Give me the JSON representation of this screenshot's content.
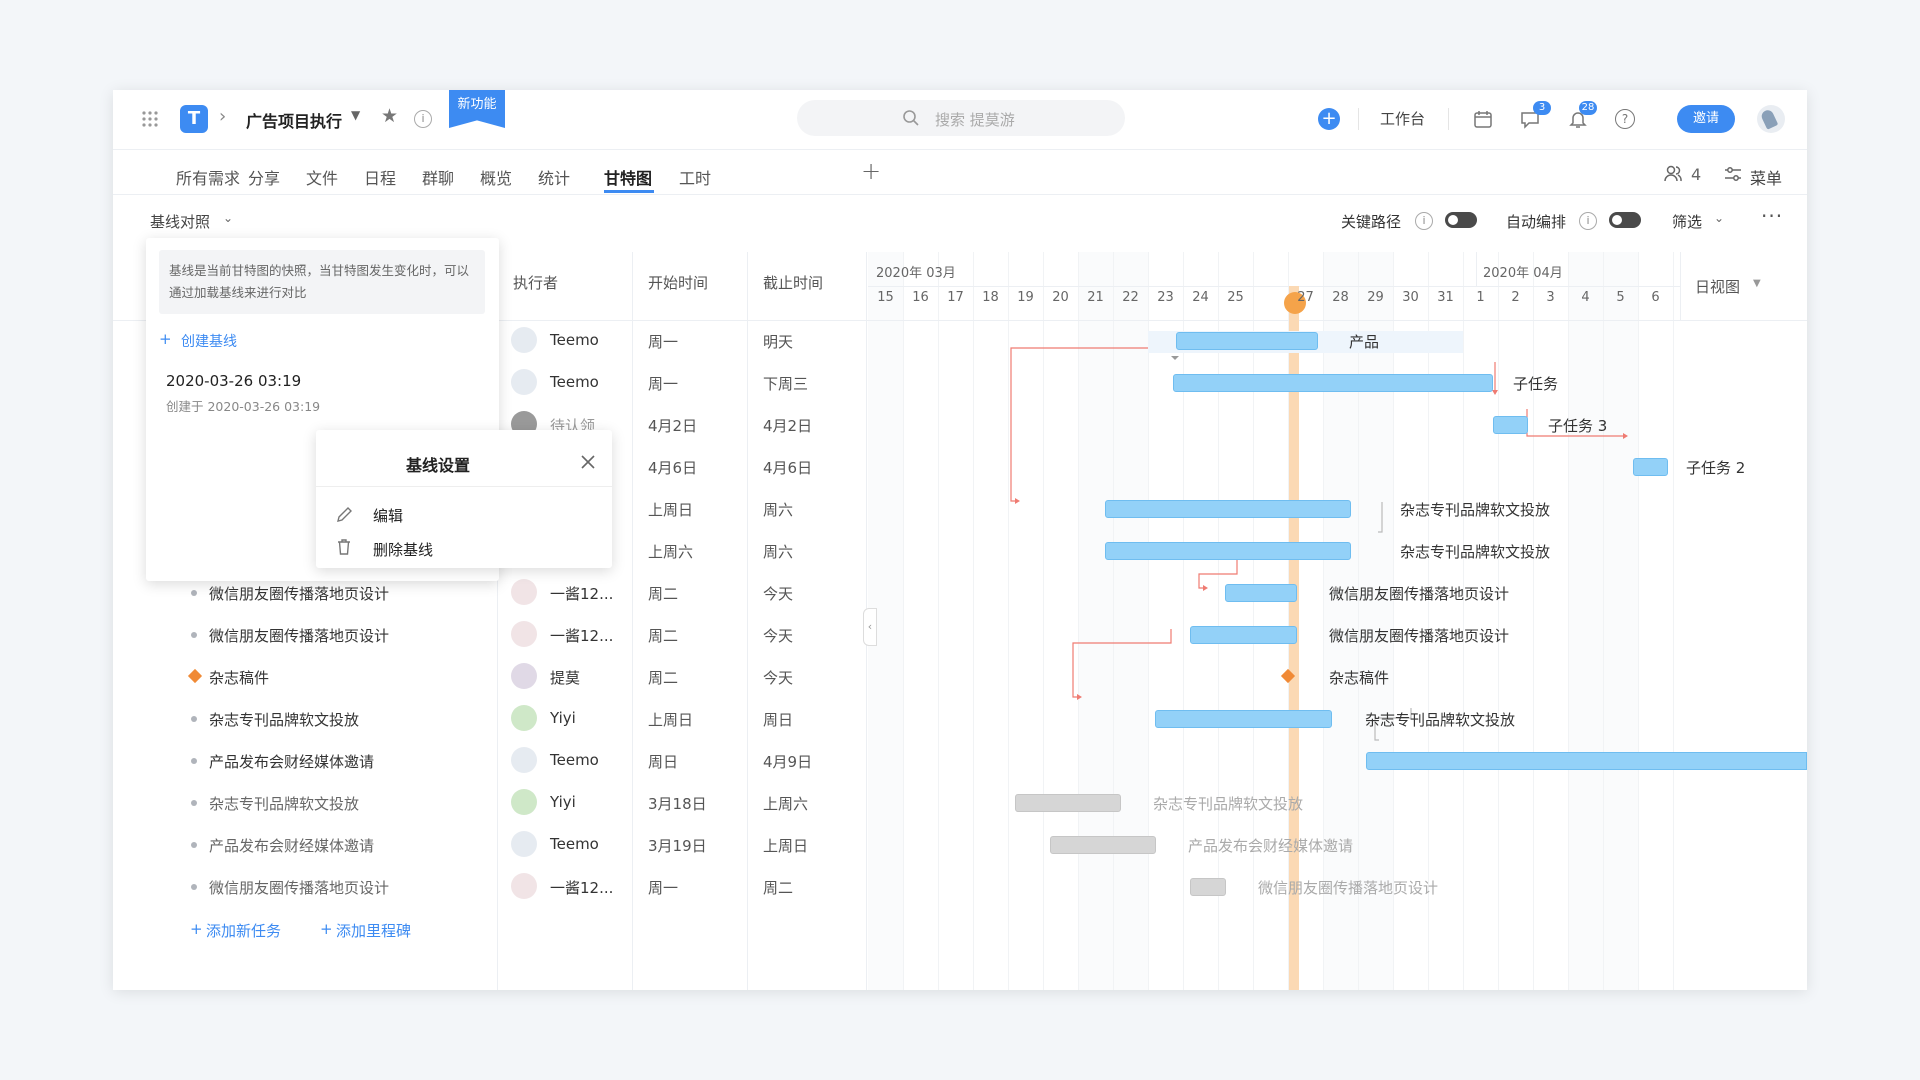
{
  "header": {
    "project_name": "广告项目执行",
    "new_feature_badge": "新功能",
    "search_placeholder": "搜索 提莫游",
    "workbench_label": "工作台",
    "message_badge": "3",
    "notification_badge": "28",
    "invite_label": "邀请"
  },
  "tabs": [
    {
      "label": "所有需求"
    },
    {
      "label": "分享"
    },
    {
      "label": "文件"
    },
    {
      "label": "日程"
    },
    {
      "label": "群聊"
    },
    {
      "label": "概览"
    },
    {
      "label": "统计"
    },
    {
      "label": "甘特图"
    },
    {
      "label": "工时"
    }
  ],
  "active_tab": "甘特图",
  "tab_right": {
    "member_count": "4",
    "menu_label": "菜单"
  },
  "toolbar": {
    "baseline_compare": "基线对照",
    "critical_path": "关键路径",
    "auto_schedule": "自动编排",
    "filter": "筛选",
    "view_mode": "日视图"
  },
  "columns": {
    "assignee": "执行者",
    "start": "开始时间",
    "due": "截止时间"
  },
  "timeline": {
    "month1": "2020年 03月",
    "month2": "2020年 04月",
    "days": [
      "15",
      "16",
      "17",
      "18",
      "19",
      "20",
      "21",
      "22",
      "23",
      "24",
      "25",
      "26",
      "27",
      "28",
      "29",
      "30",
      "31",
      "1",
      "2",
      "3",
      "4",
      "5",
      "6"
    ],
    "today": "26"
  },
  "rows": [
    {
      "name": "",
      "assignee": "Teemo",
      "start": "周一",
      "due": "明天"
    },
    {
      "name": "",
      "assignee": "Teemo",
      "start": "周一",
      "due": "下周三"
    },
    {
      "name": "",
      "assignee": "待认领",
      "start": "4月2日",
      "due": "4月2日"
    },
    {
      "name": "",
      "assignee": "",
      "start": "4月6日",
      "due": "4月6日"
    },
    {
      "name": "",
      "assignee": "",
      "start": "上周日",
      "due": "周六"
    },
    {
      "name": "",
      "assignee": "",
      "start": "上周六",
      "due": "周六"
    },
    {
      "name": "微信朋友圈传播落地页设计",
      "assignee": "一酱12...",
      "start": "周二",
      "due": "今天"
    },
    {
      "name": "微信朋友圈传播落地页设计",
      "assignee": "一酱12...",
      "start": "周二",
      "due": "今天"
    },
    {
      "name": "杂志稿件",
      "assignee": "提莫",
      "start": "周二",
      "due": "今天"
    },
    {
      "name": "杂志专刊品牌软文投放",
      "assignee": "Yiyi",
      "start": "上周日",
      "due": "周日"
    },
    {
      "name": "产品发布会财经媒体邀请",
      "assignee": "Teemo",
      "start": "周日",
      "due": "4月9日"
    },
    {
      "name": "杂志专刊品牌软文投放",
      "assignee": "Yiyi",
      "start": "3月18日",
      "due": "上周六"
    },
    {
      "name": "产品发布会财经媒体邀请",
      "assignee": "Teemo",
      "start": "3月19日",
      "due": "上周日"
    },
    {
      "name": "微信朋友圈传播落地页设计",
      "assignee": "一酱12...",
      "start": "周一",
      "due": "周二"
    }
  ],
  "gantt_labels": [
    "产品",
    "子任务",
    "子任务 3",
    "子任务 2",
    "杂志专刊品牌软文投放",
    "杂志专刊品牌软文投放",
    "微信朋友圈传播落地页设计",
    "微信朋友圈传播落地页设计",
    "杂志稿件",
    "杂志专刊品牌软文投放",
    "杂志专刊品牌软文投放",
    "产品发布会财经媒体邀请",
    "微信朋友圈传播落地页设计"
  ],
  "footer": {
    "add_task": "添加新任务",
    "add_milestone": "添加里程碑"
  },
  "baseline_panel": {
    "description": "基线是当前甘特图的快照，当甘特图发生变化时，可以通过加载基线来进行对比",
    "create_label": "创建基线",
    "baseline_title": "2020-03-26 03:19",
    "baseline_created": "创建于 2020-03-26 03:19"
  },
  "settings_popup": {
    "title": "基线设置",
    "edit": "编辑",
    "delete": "删除基线"
  }
}
